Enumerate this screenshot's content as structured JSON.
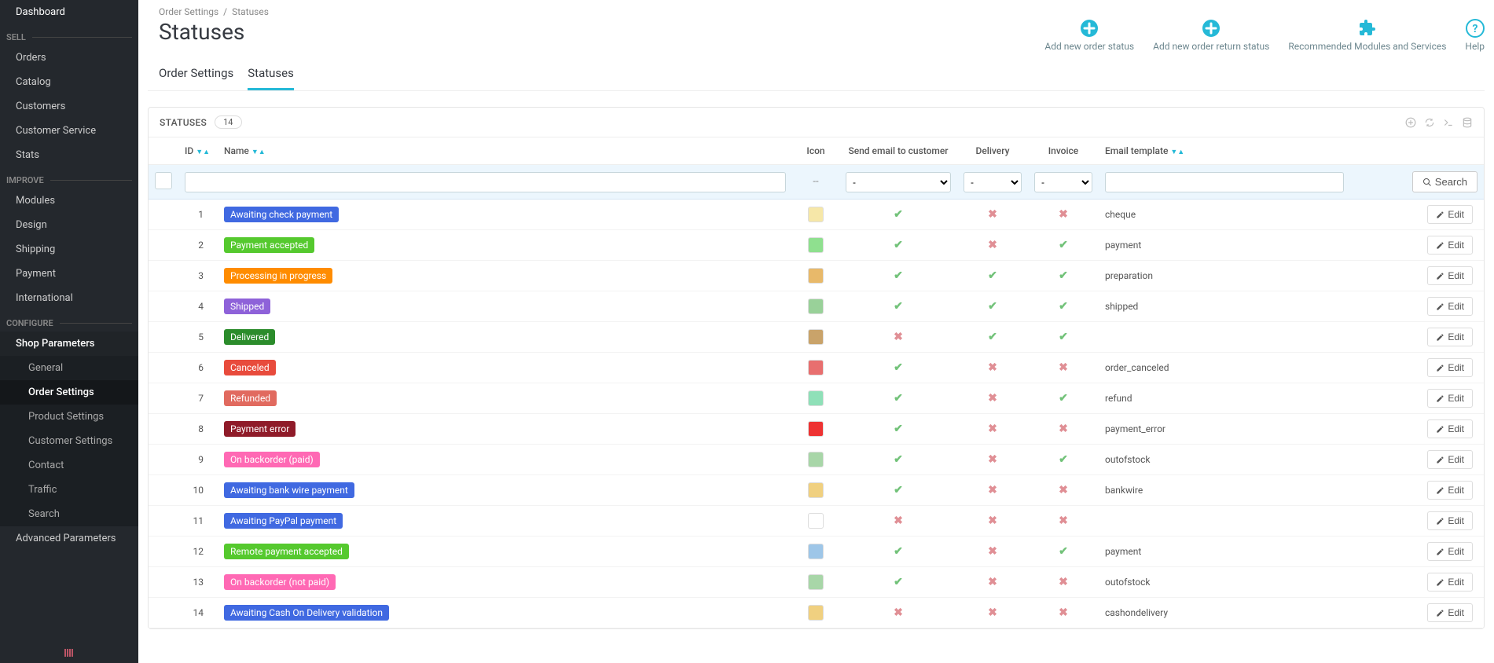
{
  "sidebar": {
    "dashboard": "Dashboard",
    "sections": [
      {
        "title": "SELL",
        "items": [
          "Orders",
          "Catalog",
          "Customers",
          "Customer Service",
          "Stats"
        ]
      },
      {
        "title": "IMPROVE",
        "items": [
          "Modules",
          "Design",
          "Shipping",
          "Payment",
          "International"
        ]
      },
      {
        "title": "CONFIGURE",
        "items": [
          "Shop Parameters",
          "Advanced Parameters"
        ]
      }
    ],
    "sub_items": [
      "General",
      "Order Settings",
      "Product Settings",
      "Customer Settings",
      "Contact",
      "Traffic",
      "Search"
    ]
  },
  "breadcrumb": {
    "parent": "Order Settings",
    "current": "Statuses"
  },
  "page_title": "Statuses",
  "header_actions": {
    "add_status": "Add new order status",
    "add_return": "Add new order return status",
    "recommended": "Recommended Modules and Services",
    "help": "Help"
  },
  "tabs": {
    "order_settings": "Order Settings",
    "statuses": "Statuses"
  },
  "panel": {
    "title": "STATUSES",
    "count": "14"
  },
  "columns": {
    "id": "ID",
    "name": "Name",
    "icon": "Icon",
    "send_email": "Send email to customer",
    "delivery": "Delivery",
    "invoice": "Invoice",
    "email_template": "Email template"
  },
  "filter": {
    "dash": "--",
    "select_dash": "-",
    "search": "Search"
  },
  "edit_label": "Edit",
  "rows": [
    {
      "id": "1",
      "name": "Awaiting check payment",
      "color": "#4069e1",
      "icon_bg": "#f6e7a8",
      "send": true,
      "delivery": false,
      "invoice": false,
      "template": "cheque"
    },
    {
      "id": "2",
      "name": "Payment accepted",
      "color": "#55c92e",
      "icon_bg": "#8fe08f",
      "send": true,
      "delivery": false,
      "invoice": true,
      "template": "payment"
    },
    {
      "id": "3",
      "name": "Processing in progress",
      "color": "#ff8c00",
      "icon_bg": "#e8b96a",
      "send": true,
      "delivery": true,
      "invoice": true,
      "template": "preparation"
    },
    {
      "id": "4",
      "name": "Shipped",
      "color": "#8e62d9",
      "icon_bg": "#99d199",
      "send": true,
      "delivery": true,
      "invoice": true,
      "template": "shipped"
    },
    {
      "id": "5",
      "name": "Delivered",
      "color": "#2b8c2b",
      "icon_bg": "#c9a36a",
      "send": false,
      "delivery": true,
      "invoice": true,
      "template": ""
    },
    {
      "id": "6",
      "name": "Canceled",
      "color": "#e84b3c",
      "icon_bg": "#e86f6f",
      "send": true,
      "delivery": false,
      "invoice": false,
      "template": "order_canceled"
    },
    {
      "id": "7",
      "name": "Refunded",
      "color": "#e16a5f",
      "icon_bg": "#8fe0b8",
      "send": true,
      "delivery": false,
      "invoice": true,
      "template": "refund"
    },
    {
      "id": "8",
      "name": "Payment error",
      "color": "#8f1b29",
      "icon_bg": "#e33",
      "send": true,
      "delivery": false,
      "invoice": false,
      "template": "payment_error"
    },
    {
      "id": "9",
      "name": "On backorder (paid)",
      "color": "#ff69b4",
      "icon_bg": "#a8d6a8",
      "send": true,
      "delivery": false,
      "invoice": true,
      "template": "outofstock"
    },
    {
      "id": "10",
      "name": "Awaiting bank wire payment",
      "color": "#4069e1",
      "icon_bg": "#f0d080",
      "send": true,
      "delivery": false,
      "invoice": false,
      "template": "bankwire"
    },
    {
      "id": "11",
      "name": "Awaiting PayPal payment",
      "color": "#4069e1",
      "icon_bg": "#ffffff",
      "send": false,
      "delivery": false,
      "invoice": false,
      "template": ""
    },
    {
      "id": "12",
      "name": "Remote payment accepted",
      "color": "#55c92e",
      "icon_bg": "#9ec6e8",
      "send": true,
      "delivery": false,
      "invoice": true,
      "template": "payment"
    },
    {
      "id": "13",
      "name": "On backorder (not paid)",
      "color": "#ff69b4",
      "icon_bg": "#a8d6a8",
      "send": true,
      "delivery": false,
      "invoice": false,
      "template": "outofstock"
    },
    {
      "id": "14",
      "name": "Awaiting Cash On Delivery validation",
      "color": "#4069e1",
      "icon_bg": "#f0d080",
      "send": false,
      "delivery": false,
      "invoice": false,
      "template": "cashondelivery"
    }
  ]
}
